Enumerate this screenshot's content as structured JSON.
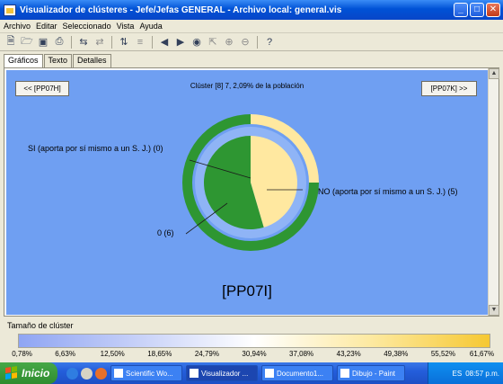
{
  "window": {
    "title": "Visualizador de clústeres - Jefe/Jefas GENERAL - Archivo local: general.vis",
    "minimize": "_",
    "maximize": "□",
    "close": "✕"
  },
  "menu": {
    "items": [
      "Archivo",
      "Editar",
      "Seleccionado",
      "Vista",
      "Ayuda"
    ]
  },
  "toolbar": {
    "icons": [
      "new-file-icon",
      "open-file-icon",
      "save-icon",
      "print-icon",
      "swap-icon",
      "redo-icon",
      "sort-icon",
      "filter-icon",
      "back-arrow-icon",
      "forward-arrow-icon",
      "binoculars-icon",
      "zoom-select-icon",
      "zoom-in-icon",
      "zoom-out-icon",
      "help-icon"
    ]
  },
  "tabs": [
    "Gráficos",
    "Texto",
    "Detalles"
  ],
  "cluster": {
    "prev_button": "<< [PP07H]",
    "next_button": "[PP07K] >>",
    "info": "Clúster [8] 7, 2,09% de la población",
    "variable": "[PP07I]"
  },
  "chart_data": {
    "type": "pie",
    "title": "[PP07I]",
    "categories": [
      "SI (aporta por sí mismo a un S. J.) (0)",
      "NO (aporta por sí mismo a un S. J.) (5)",
      "0 (6)"
    ],
    "values": [
      0,
      5,
      6
    ],
    "colors": [
      "#ffffff",
      "#ffe8a0",
      "#2e9632"
    ],
    "outer_ring": {
      "note_colors": {
        "yellow": "#ffe8a0",
        "green": "#2e9632"
      },
      "values": [
        0,
        0.25,
        0.75
      ]
    }
  },
  "legend": {
    "title": "Tamaño de clúster",
    "ticks": [
      "0,78%",
      "6,63%",
      "12,50%",
      "18,65%",
      "24,79%",
      "30,94%",
      "37,08%",
      "43,23%",
      "49,38%",
      "55,52%",
      "61,67%"
    ]
  },
  "taskbar": {
    "start": "Inicio",
    "items": [
      {
        "label": "Scientific Wo...",
        "active": false
      },
      {
        "label": "Visualizador ...",
        "active": true
      },
      {
        "label": "Documento1...",
        "active": false
      },
      {
        "label": "Dibujo - Paint",
        "active": false
      }
    ],
    "language": "ES",
    "clock": "08:57 p.m."
  }
}
